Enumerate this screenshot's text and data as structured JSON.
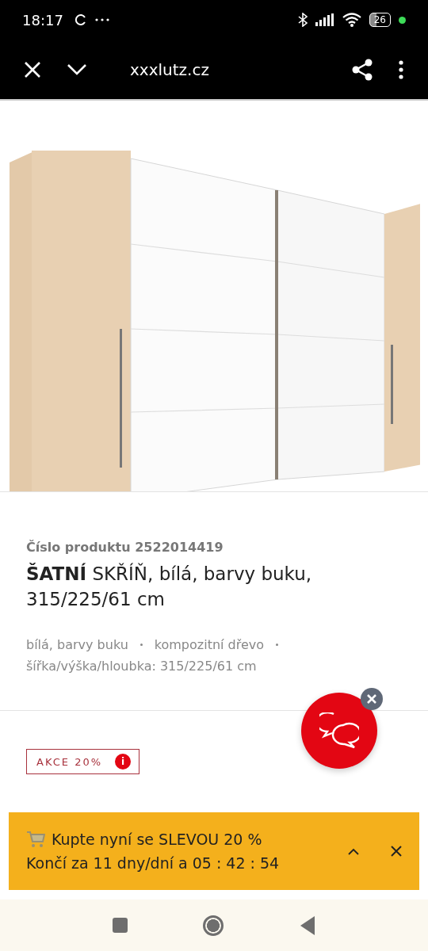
{
  "status_bar": {
    "time": "18:17",
    "battery": "26"
  },
  "toolbar": {
    "url": "xxxlutz.cz"
  },
  "product": {
    "number_label": "Číslo produktu 2522014419",
    "title": "**ŠATNÍ** SKŘÍŇ, bílá, barvy buku, 315/225/61 cm",
    "attributes": [
      "bílá, barvy buku",
      "kompozitní dřevo",
      "šířka/výška/hloubka: 315/225/61 cm"
    ],
    "badge": {
      "label": "AKCE 20%",
      "info": "i"
    }
  },
  "promo_banner": {
    "headline": "Kupte nyní se SLEVOU 20 %",
    "countdown": "Končí za 11 dny/dní a  05 : 42 : 54"
  }
}
